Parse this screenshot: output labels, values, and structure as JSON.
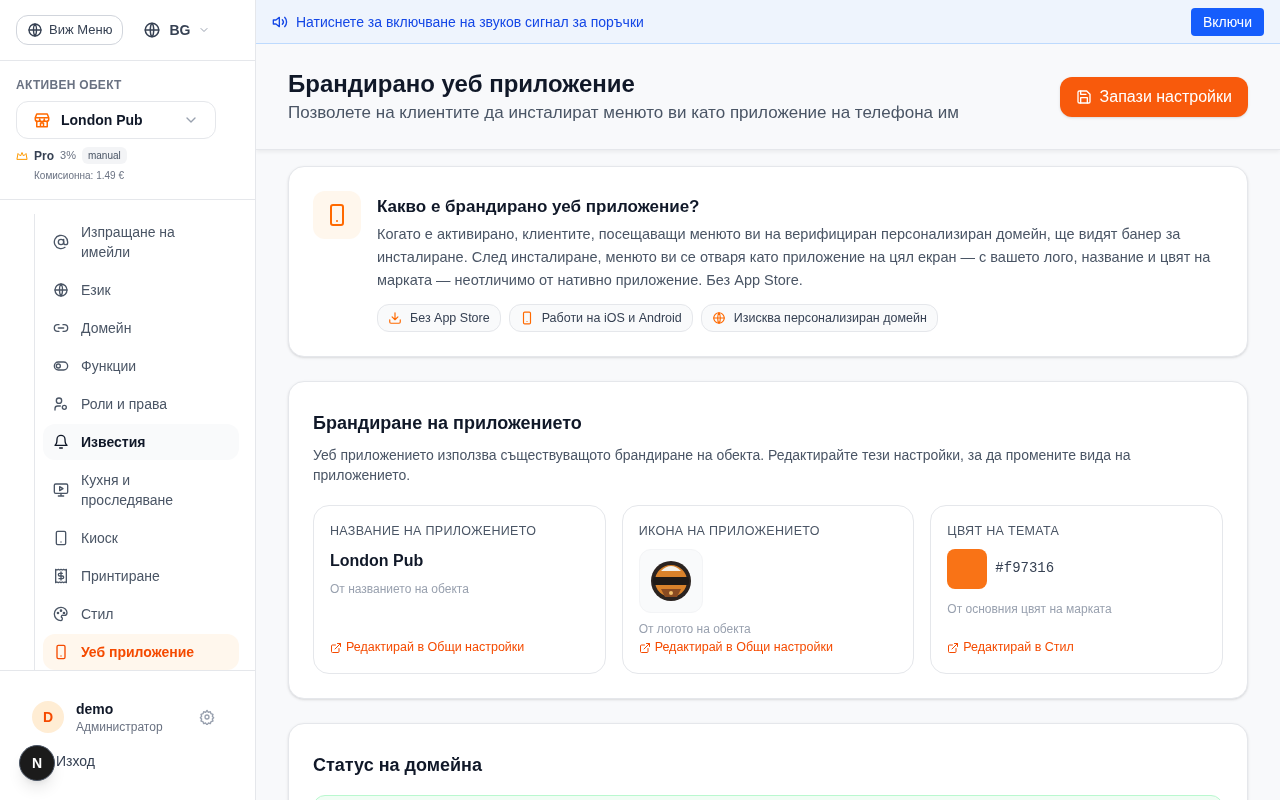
{
  "sidebar": {
    "view_menu_button": "Виж Меню",
    "language": "BG",
    "active_object_label": "АКТИВЕН ОБЕКТ",
    "active_object": "London Pub",
    "plan": {
      "name": "Pro",
      "percent": "3%",
      "badge": "manual",
      "commission": "Комисионна: 1.49 €"
    },
    "nav": [
      {
        "label": "Изпращане на имейли",
        "selected": false,
        "hovered": false
      },
      {
        "label": "Език",
        "selected": false,
        "hovered": false
      },
      {
        "label": "Домейн",
        "selected": false,
        "hovered": false
      },
      {
        "label": "Функции",
        "selected": false,
        "hovered": false
      },
      {
        "label": "Роли и права",
        "selected": false,
        "hovered": false
      },
      {
        "label": "Известия",
        "selected": false,
        "hovered": true
      },
      {
        "label": "Кухня и проследяване",
        "selected": false,
        "hovered": false
      },
      {
        "label": "Киоск",
        "selected": false,
        "hovered": false
      },
      {
        "label": "Принтиране",
        "selected": false,
        "hovered": false
      },
      {
        "label": "Стил",
        "selected": false,
        "hovered": false
      },
      {
        "label": "Уеб приложение",
        "selected": true,
        "hovered": false
      }
    ],
    "user": {
      "initial": "D",
      "name": "demo",
      "role": "Администратор"
    },
    "logout": "Изход"
  },
  "dev_badge": "N",
  "sound_banner": {
    "text": "Натиснете за включване на звуков сигнал за поръчки",
    "button": "Включи"
  },
  "header": {
    "title": "Брандирано уеб приложение",
    "subtitle": "Позволете на клиентите да инсталират менюто ви като приложение на телефона им",
    "save_button": "Запази настройки"
  },
  "info_card": {
    "title": "Какво е брандирано уеб приложение?",
    "text": "Когато е активирано, клиентите, посещаващи менюто ви на верифициран персонализиран домейн, ще видят банер за инсталиране. След инсталиране, менюто ви се отваря като приложение на цял екран — с вашето лого, название и цвят на марката — неотличимо от нативно приложение. Без App Store.",
    "chips": [
      {
        "label": "Без App Store"
      },
      {
        "label": "Работи на iOS и Android"
      },
      {
        "label": "Изисква персонализиран домейн"
      }
    ]
  },
  "branding_card": {
    "title": "Брандиране на приложението",
    "text": "Уеб приложението използва съществуващото брандиране на обекта. Редактирайте тези настройки, за да промените вида на приложението.",
    "tiles": [
      {
        "kind": "name",
        "label": "НАЗВАНИЕ НА ПРИЛОЖЕНИЕТО",
        "value": "London Pub",
        "hint": "От названието на обекта",
        "link": "Редактирай в Общи настройки"
      },
      {
        "kind": "icon",
        "label": "ИКОНА НА ПРИЛОЖЕНИЕТО",
        "hint": "От логото на обекта",
        "link": "Редактирай в Общи настройки"
      },
      {
        "kind": "color",
        "label": "ЦВЯТ НА ТЕМАТА",
        "value": "#f97316",
        "color": "#f97316",
        "hint": "От основния цвят на марката",
        "link": "Редактирай в Стил"
      }
    ]
  },
  "domain_card": {
    "title": "Статус на домейна"
  }
}
